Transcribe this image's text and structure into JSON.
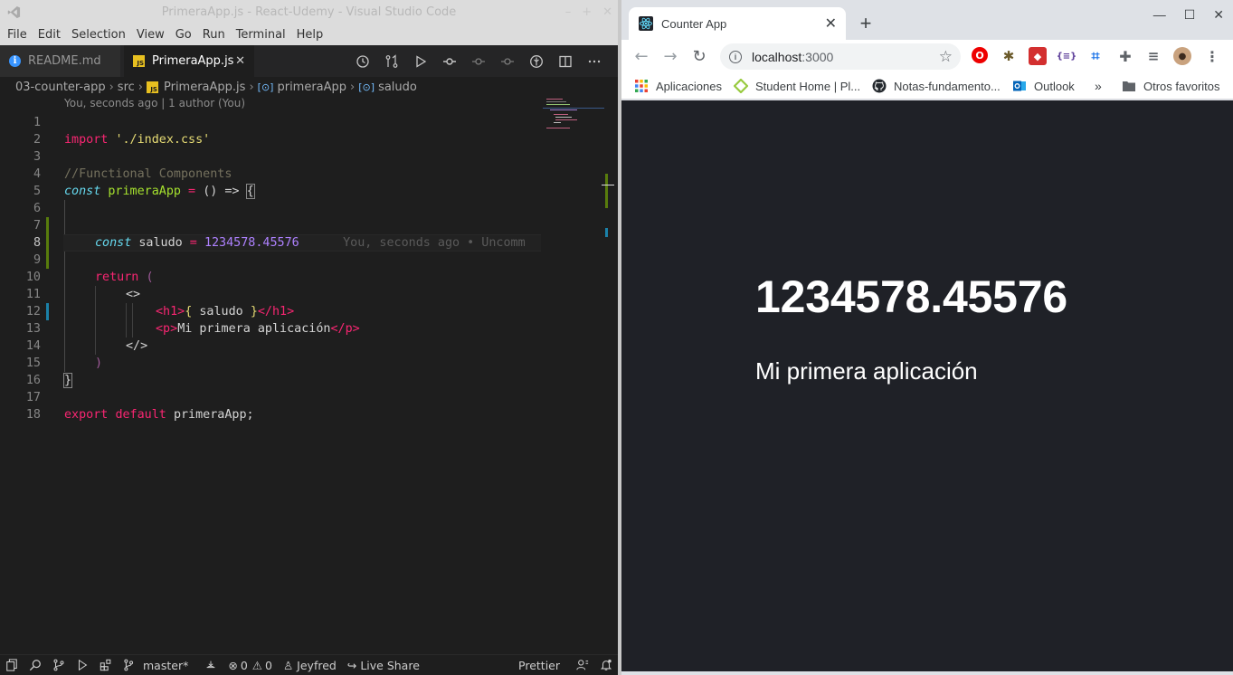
{
  "vscode": {
    "title": "PrimeraApp.js - React-Udemy - Visual Studio Code",
    "menu": [
      "File",
      "Edit",
      "Selection",
      "View",
      "Go",
      "Run",
      "Terminal",
      "Help"
    ],
    "tabs": [
      {
        "label": "README.md",
        "active": false
      },
      {
        "label": "PrimeraApp.js",
        "active": true
      }
    ],
    "breadcrumb": [
      "03-counter-app",
      "src",
      "PrimeraApp.js",
      "primeraApp",
      "saludo"
    ],
    "codelens": "You, seconds ago | 1 author (You)",
    "lines": {
      "l1": "1",
      "l2": "2",
      "l3": "3",
      "l4": "4",
      "l5": "5",
      "l6": "6",
      "l7": "7",
      "l8": "8",
      "l9": "9",
      "l10": "10",
      "l11": "11",
      "l12": "12",
      "l13": "13",
      "l14": "14",
      "l15": "15",
      "l16": "16",
      "l17": "17",
      "l18": "18"
    },
    "code": {
      "import_kw": "import",
      "import_path": "'./index.css'",
      "comment": "//Functional Components",
      "const_kw": "const",
      "component_name": "primeraApp",
      "eq": " = ",
      "arrow_fn": "() =>",
      "open_brace": "{",
      "saludo_name": "saludo",
      "saludo_value": "1234578.45576",
      "blame": "You, seconds ago • Uncomm",
      "return_kw": "return",
      "open_paren": "(",
      "fragment_open": "<>",
      "h1_open": "<h1>",
      "h1_expr_open": "{",
      "h1_expr": " saludo ",
      "h1_expr_close": "}",
      "h1_close": "</h1>",
      "p_open": "<p>",
      "p_text": "Mi primera aplicación",
      "p_close": "</p>",
      "fragment_close": "</>",
      "close_paren": ")",
      "close_brace": "}",
      "export_kw": "export",
      "default_kw": "default",
      "export_name": "primeraApp;"
    },
    "status": {
      "branch": "master*",
      "errors": "0",
      "warnings": "0",
      "user": "Jeyfred",
      "live_share": "Live Share",
      "formatter": "Prettier"
    },
    "colors": {
      "keyword": "#f92672",
      "storage": "#66d9ef",
      "string": "#e6db74",
      "comment": "#75715e",
      "number": "#ae81ff",
      "function": "#a6e22e"
    }
  },
  "chrome": {
    "tab_title": "Counter App",
    "url_host": "localhost",
    "url_port": ":3000",
    "bookmarks": [
      "Aplicaciones",
      "Student Home | Pl...",
      "Notas-fundamento...",
      "Outlook"
    ],
    "bookmarks_more": "»",
    "other_bookmarks": "Otros favoritos",
    "page": {
      "heading": "1234578.45576",
      "paragraph": "Mi primera aplicación",
      "background": "#1f2127"
    }
  }
}
